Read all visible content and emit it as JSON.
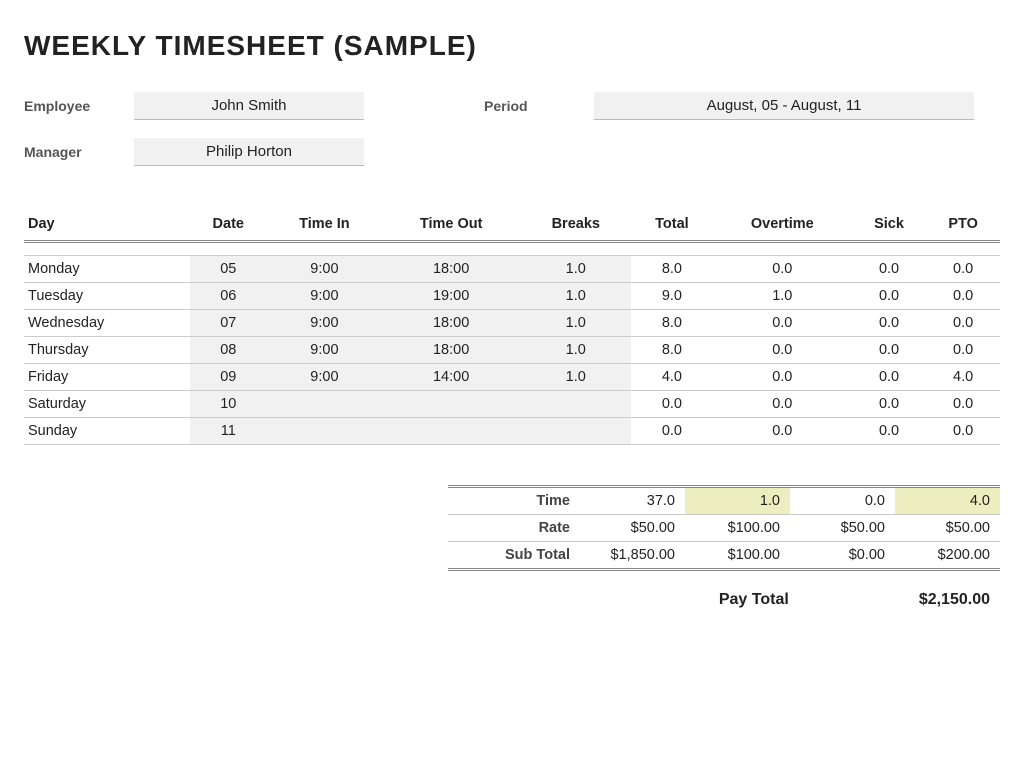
{
  "title": "WEEKLY TIMESHEET (SAMPLE)",
  "meta": {
    "employee_label": "Employee",
    "employee_value": "John Smith",
    "period_label": "Period",
    "period_value": "August, 05 - August, 11",
    "manager_label": "Manager",
    "manager_value": "Philip Horton"
  },
  "columns": {
    "day": "Day",
    "date": "Date",
    "time_in": "Time In",
    "time_out": "Time Out",
    "breaks": "Breaks",
    "total": "Total",
    "overtime": "Overtime",
    "sick": "Sick",
    "pto": "PTO"
  },
  "rows": [
    {
      "day": "Monday",
      "date": "05",
      "in": "9:00",
      "out": "18:00",
      "breaks": "1.0",
      "total": "8.0",
      "ot": "0.0",
      "sick": "0.0",
      "pto": "0.0"
    },
    {
      "day": "Tuesday",
      "date": "06",
      "in": "9:00",
      "out": "19:00",
      "breaks": "1.0",
      "total": "9.0",
      "ot": "1.0",
      "sick": "0.0",
      "pto": "0.0"
    },
    {
      "day": "Wednesday",
      "date": "07",
      "in": "9:00",
      "out": "18:00",
      "breaks": "1.0",
      "total": "8.0",
      "ot": "0.0",
      "sick": "0.0",
      "pto": "0.0"
    },
    {
      "day": "Thursday",
      "date": "08",
      "in": "9:00",
      "out": "18:00",
      "breaks": "1.0",
      "total": "8.0",
      "ot": "0.0",
      "sick": "0.0",
      "pto": "0.0"
    },
    {
      "day": "Friday",
      "date": "09",
      "in": "9:00",
      "out": "14:00",
      "breaks": "1.0",
      "total": "4.0",
      "ot": "0.0",
      "sick": "0.0",
      "pto": "4.0"
    },
    {
      "day": "Saturday",
      "date": "10",
      "in": "",
      "out": "",
      "breaks": "",
      "total": "0.0",
      "ot": "0.0",
      "sick": "0.0",
      "pto": "0.0"
    },
    {
      "day": "Sunday",
      "date": "11",
      "in": "",
      "out": "",
      "breaks": "",
      "total": "0.0",
      "ot": "0.0",
      "sick": "0.0",
      "pto": "0.0"
    }
  ],
  "summary": {
    "time_label": "Time",
    "rate_label": "Rate",
    "sub_label": "Sub Total",
    "time": {
      "total": "37.0",
      "ot": "1.0",
      "sick": "0.0",
      "pto": "4.0"
    },
    "rate": {
      "total": "$50.00",
      "ot": "$100.00",
      "sick": "$50.00",
      "pto": "$50.00"
    },
    "subtotal": {
      "total": "$1,850.00",
      "ot": "$100.00",
      "sick": "$0.00",
      "pto": "$200.00"
    }
  },
  "pay": {
    "label": "Pay Total",
    "value": "$2,150.00"
  }
}
